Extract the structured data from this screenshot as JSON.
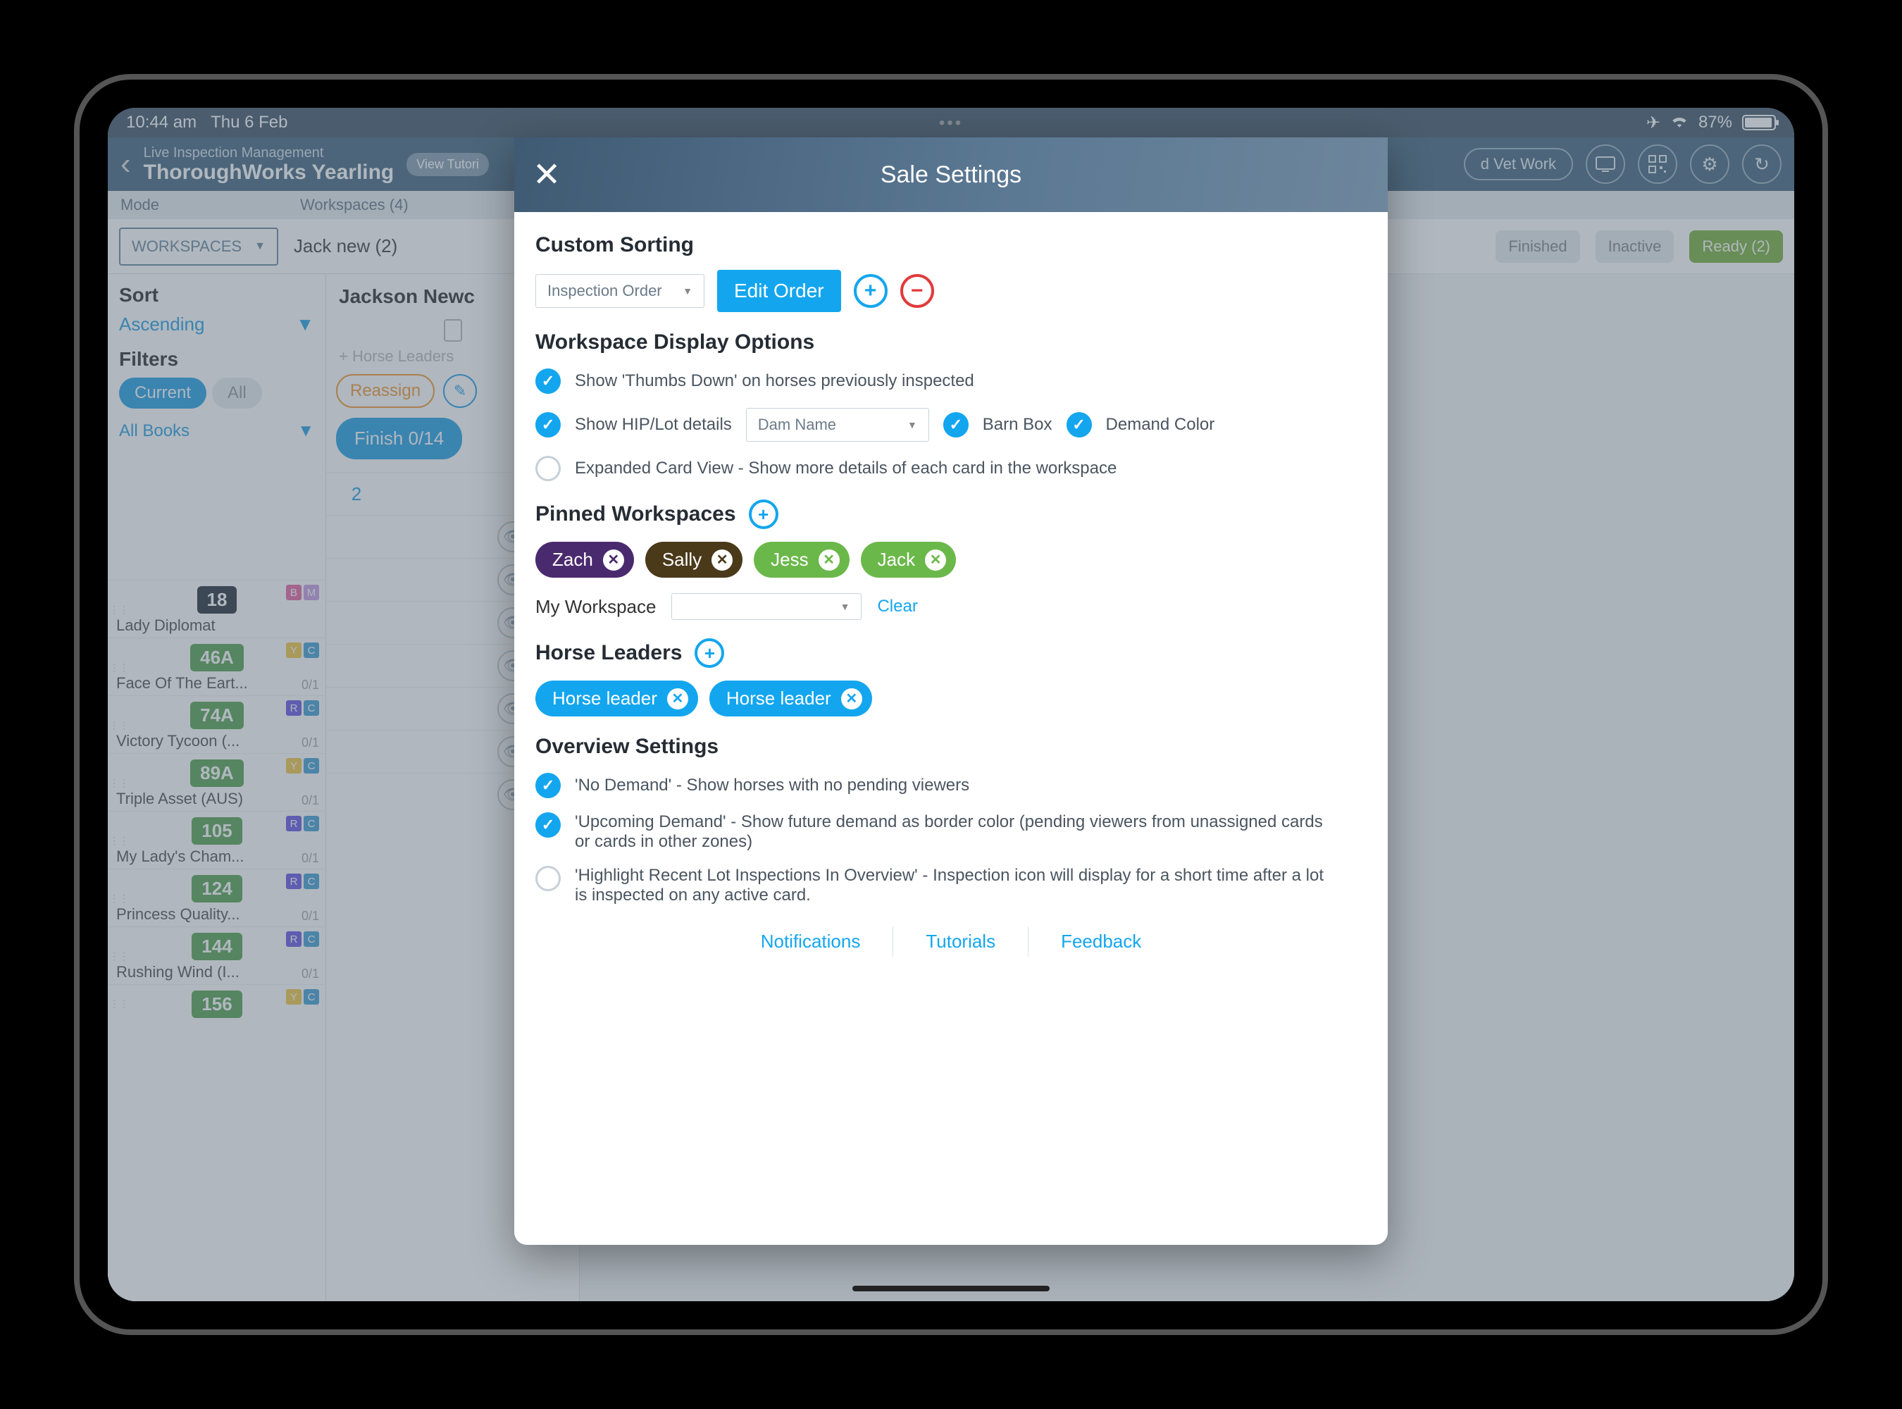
{
  "status": {
    "time": "10:44 am",
    "date": "Thu 6 Feb",
    "battery_pct": "87%"
  },
  "header": {
    "subtitle": "Live Inspection Management",
    "title": "ThoroughWorks Yearling",
    "view_tut": "View Tutori",
    "vet_work": "d Vet Work"
  },
  "subhdr": {
    "mode": "Mode",
    "workspaces": "Workspaces (4)"
  },
  "moderow": {
    "mode_sel": "WORKSPACES",
    "ws_label": "Jack new (2)",
    "finished": "Finished",
    "inactive": "Inactive",
    "ready": "Ready (2)"
  },
  "sidebar": {
    "sort": "Sort",
    "sort_val": "Ascending",
    "filters": "Filters",
    "chip_current": "Current",
    "chip_all": "All",
    "all_books": "All Books"
  },
  "lots": {
    "title": "Jackson Newc",
    "horse_leaders": "+ Horse Leaders",
    "reassign": "Reassign",
    "finish": "Finish 0/14",
    "first_num": "2"
  },
  "horses": [
    {
      "hip": "18",
      "cls": "dark",
      "name": "Lady Diplomat",
      "tags": [
        "B",
        "M"
      ],
      "ct": ""
    },
    {
      "hip": "46A",
      "cls": "green",
      "name": "Face Of The Eart...",
      "tags": [
        "Y",
        "C"
      ],
      "ct": "0/1"
    },
    {
      "hip": "74A",
      "cls": "green",
      "name": "Victory Tycoon (...",
      "tags": [
        "R",
        "C"
      ],
      "ct": "0/1"
    },
    {
      "hip": "89A",
      "cls": "green",
      "name": "Triple Asset (AUS)",
      "tags": [
        "Y",
        "C"
      ],
      "ct": "0/1"
    },
    {
      "hip": "105",
      "cls": "green",
      "name": "My Lady's Cham...",
      "tags": [
        "R",
        "C"
      ],
      "ct": "0/1"
    },
    {
      "hip": "124",
      "cls": "green",
      "name": "Princess Quality...",
      "tags": [
        "R",
        "C"
      ],
      "ct": "0/1"
    },
    {
      "hip": "144",
      "cls": "green",
      "name": "Rushing Wind (I...",
      "tags": [
        "R",
        "C"
      ],
      "ct": "0/1"
    },
    {
      "hip": "156",
      "cls": "green",
      "name": "",
      "tags": [
        "Y",
        "C"
      ],
      "ct": ""
    }
  ],
  "modal": {
    "title": "Sale Settings",
    "custom_sorting": "Custom Sorting",
    "sort_dd": "Inspection Order",
    "edit_order": "Edit Order",
    "wdo": "Workspace Display Options",
    "opt_thumbs": "Show 'Thumbs Down' on horses previously inspected",
    "opt_hip": "Show HIP/Lot details",
    "hip_dd": "Dam Name",
    "barn_box": "Barn Box",
    "demand_color": "Demand Color",
    "opt_expanded": "Expanded Card View - Show more details of each card in the workspace",
    "pinned": "Pinned Workspaces",
    "pins": {
      "zach": "Zach",
      "sally": "Sally",
      "jess": "Jess",
      "jack": "Jack"
    },
    "my_ws_label": "My Workspace",
    "clear": "Clear",
    "horse_leaders": "Horse Leaders",
    "hl1": "Horse leader",
    "hl2": "Horse leader",
    "overview": "Overview Settings",
    "ov_nodemand": "'No Demand' - Show horses with no pending viewers",
    "ov_upcoming": "'Upcoming Demand' - Show future demand as border color (pending viewers from unassigned cards or cards in other zones)",
    "ov_highlight": "'Highlight Recent Lot Inspections In Overview' - Inspection icon will display for a short time after a lot is inspected on any active card.",
    "f_notif": "Notifications",
    "f_tut": "Tutorials",
    "f_fb": "Feedback"
  }
}
